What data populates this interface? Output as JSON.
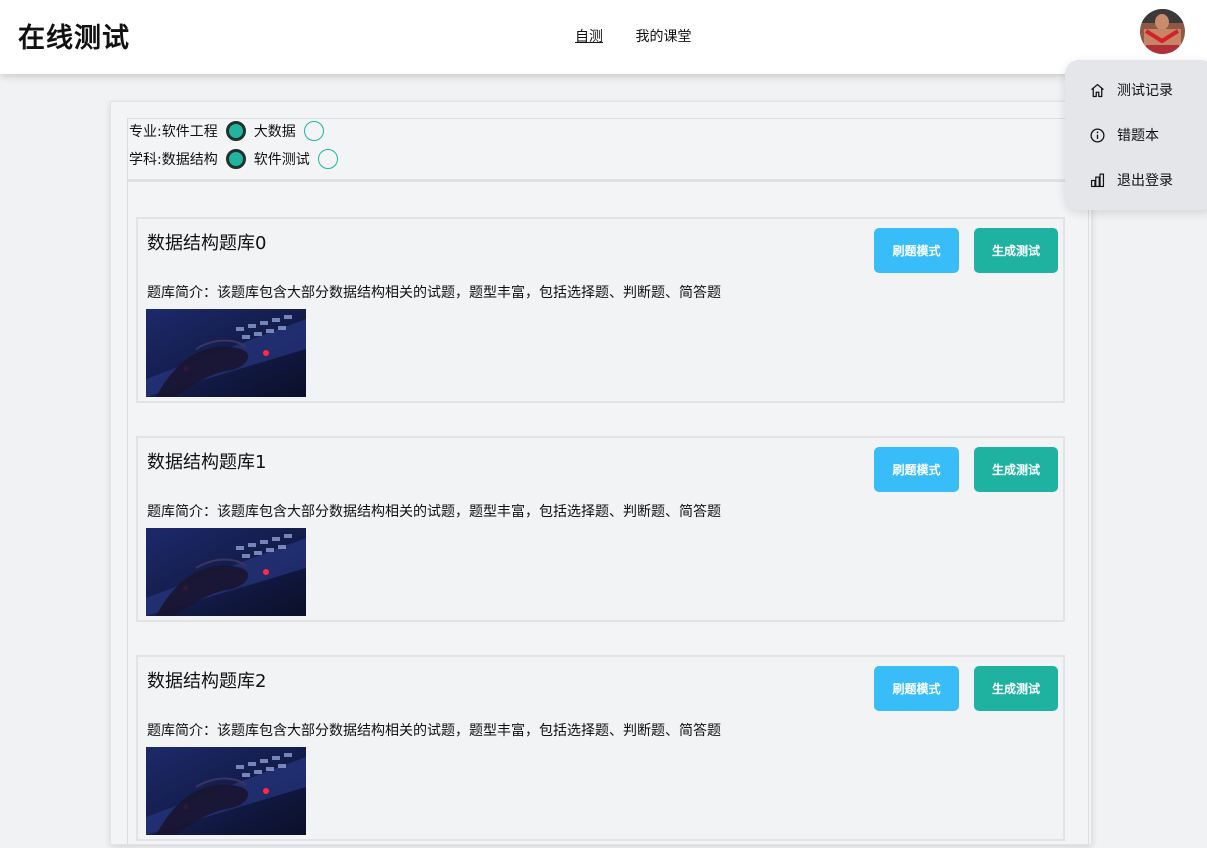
{
  "header": {
    "title": "在线测试",
    "nav": [
      {
        "label": "自测",
        "active": true
      },
      {
        "label": "我的课堂",
        "active": false
      }
    ]
  },
  "user_menu": {
    "items": [
      {
        "label": "测试记录",
        "icon": "home-icon"
      },
      {
        "label": "错题本",
        "icon": "info-icon"
      },
      {
        "label": "退出登录",
        "icon": "bar-chart-icon"
      }
    ]
  },
  "filters": {
    "major": {
      "label": "专业: ",
      "options": [
        {
          "label": "软件工程",
          "selected": true
        },
        {
          "label": "大数据",
          "selected": false
        }
      ]
    },
    "subject": {
      "label": "学科: ",
      "options": [
        {
          "label": "数据结构",
          "selected": true
        },
        {
          "label": "软件测试",
          "selected": false
        }
      ]
    }
  },
  "question_banks": [
    {
      "title": "数据结构题库0",
      "description": "题库简介：该题库包含大部分数据结构相关的试题，题型丰富，包括选择题、判断题、简答题"
    },
    {
      "title": "数据结构题库1",
      "description": "题库简介：该题库包含大部分数据结构相关的试题，题型丰富，包括选择题、判断题、简答题"
    },
    {
      "title": "数据结构题库2",
      "description": "题库简介：该题库包含大部分数据结构相关的试题，题型丰富，包括选择题、判断题、简答题"
    }
  ],
  "buttons": {
    "practice_label": "刷题模式",
    "generate_label": "生成测试"
  },
  "colors": {
    "practice_button": "#38bdf8",
    "generate_button": "#20b2a0",
    "radio_accent": "#21b5a0"
  }
}
